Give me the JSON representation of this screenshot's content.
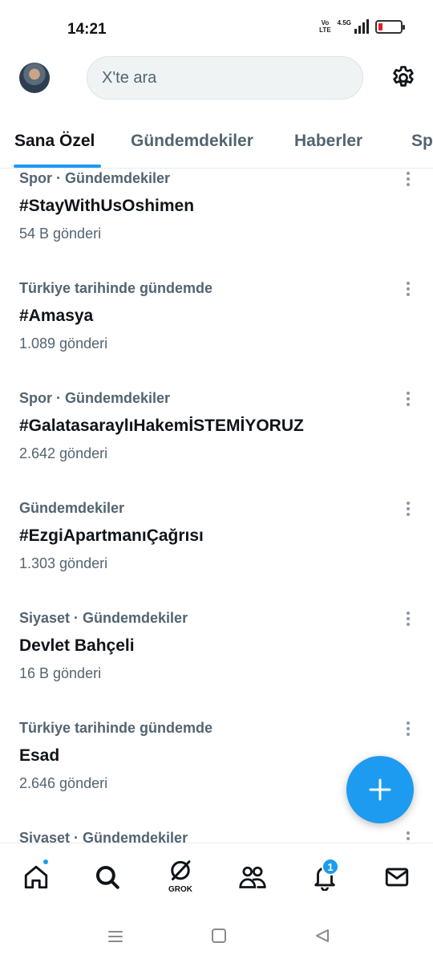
{
  "status": {
    "time": "14:21",
    "volte_top": "Vo",
    "volte_bottom": "LTE",
    "network": "4.5G"
  },
  "top_bar": {
    "search_placeholder": "X'te ara"
  },
  "tabs": [
    {
      "label": "Sana Özel",
      "active": true
    },
    {
      "label": "Gündemdekiler",
      "active": false
    },
    {
      "label": "Haberler",
      "active": false
    },
    {
      "label": "Spor",
      "active": false
    }
  ],
  "trends": [
    {
      "context": "Spor · Gündemdekiler",
      "name": "#StayWithUsOshimen",
      "count": "54 B gönderi"
    },
    {
      "context": "Türkiye tarihinde gündemde",
      "name": "#Amasya",
      "count": "1.089 gönderi"
    },
    {
      "context": "Spor · Gündemdekiler",
      "name": "#GalatasaraylıHakemİSTEMİYORUZ",
      "count": "2.642 gönderi"
    },
    {
      "context": "Gündemdekiler",
      "name": "#EzgiApartmanıÇağrısı",
      "count": "1.303 gönderi"
    },
    {
      "context": "Siyaset · Gündemdekiler",
      "name": "Devlet Bahçeli",
      "count": "16 B gönderi"
    },
    {
      "context": "Türkiye tarihinde gündemde",
      "name": "Esad",
      "count": "2.646 gönderi"
    },
    {
      "context": "Siyaset · Gündemdekiler",
      "name": "",
      "count": ""
    }
  ],
  "bottom_nav": {
    "items": [
      "home-icon",
      "search-icon",
      "grok-icon",
      "communities-icon",
      "notifications-icon",
      "messages-icon"
    ],
    "grok_label": "GROK",
    "notification_count": "1"
  },
  "colors": {
    "accent": "#1d9bf0",
    "text_primary": "#0f1419",
    "text_secondary": "#536471"
  }
}
